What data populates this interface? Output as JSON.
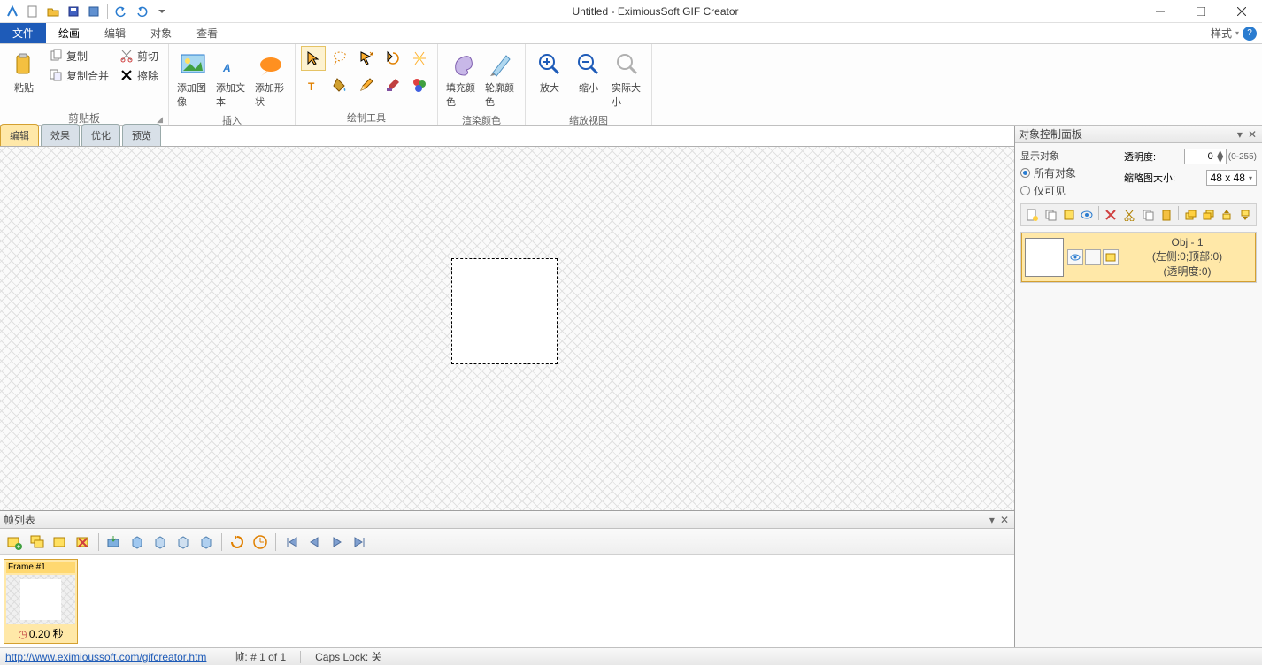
{
  "title": "Untitled - EximiousSoft GIF Creator",
  "qat_icons": [
    "app",
    "new",
    "open",
    "save",
    "import",
    "undo",
    "redo"
  ],
  "menu": {
    "tabs": [
      "文件",
      "绘画",
      "编辑",
      "对象",
      "查看"
    ],
    "active_index": 0,
    "selected_index": 1,
    "style_label": "样式"
  },
  "ribbon": {
    "clipboard": {
      "paste": "粘贴",
      "copy": "复制",
      "cut": "剪切",
      "copy_merge": "复制合并",
      "erase": "擦除",
      "group_label": "剪贴板"
    },
    "insert": {
      "add_image": "添加图像",
      "add_text": "添加文本",
      "add_shape": "添加形状",
      "group_label": "插入"
    },
    "tools": {
      "group_label": "绘制工具"
    },
    "color": {
      "fill": "填充颜色",
      "outline": "轮廓颜色",
      "group_label": "渲染颜色"
    },
    "zoom": {
      "zoom_in": "放大",
      "zoom_out": "缩小",
      "actual": "实际大小",
      "group_label": "缩放视图"
    }
  },
  "left_tabs": [
    "编辑",
    "效果",
    "优化",
    "预览"
  ],
  "frame_panel": {
    "title": "帧列表",
    "frame": {
      "name": "Frame #1",
      "time": "0.20 秒"
    }
  },
  "right_panel": {
    "title": "对象控制面板",
    "show_objects": "显示对象",
    "all_objects": "所有对象",
    "only_visible": "仅可见",
    "opacity_label": "透明度:",
    "opacity_value": "0",
    "opacity_range": "(0-255)",
    "thumb_label": "缩略图大小:",
    "thumb_value": "48 x 48",
    "obj": {
      "name": "Obj - 1",
      "pos": "(左侧:0;顶部:0)",
      "opacity": "(透明度:0)"
    }
  },
  "status": {
    "url": "http://www.eximioussoft.com/gifcreator.htm",
    "frame": "帧: # 1 of 1",
    "caps": "Caps Lock: 关"
  }
}
